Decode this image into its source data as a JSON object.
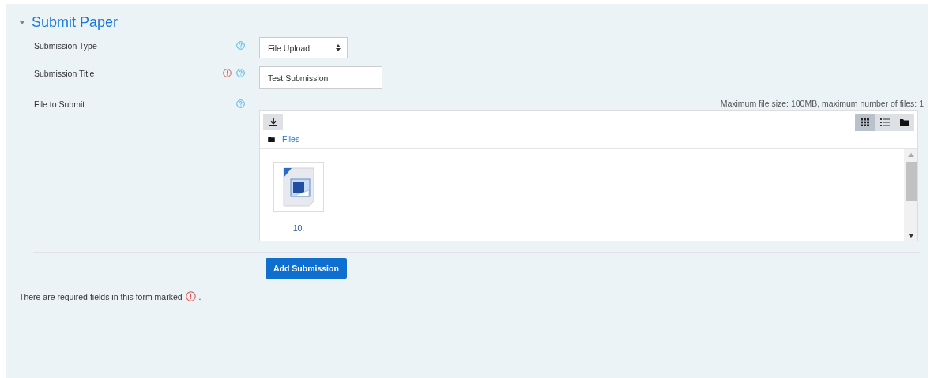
{
  "section": {
    "title": "Submit Paper",
    "expanded": true
  },
  "fields": [
    {
      "kind": "select",
      "label": "Submission Type",
      "required": false,
      "value": "File Upload"
    },
    {
      "kind": "text",
      "label": "Submission Title",
      "required": true,
      "value": "Test Submission"
    },
    {
      "kind": "filepicker",
      "label": "File to Submit",
      "required": false,
      "limits": "Maximum file size: 100MB, maximum number of files: 1",
      "path": "Files",
      "views": [
        {
          "kind": "icons",
          "selected": true
        },
        {
          "kind": "list",
          "selected": false
        },
        {
          "kind": "tree",
          "selected": false
        }
      ],
      "files": [
        {
          "name": "10."
        }
      ]
    }
  ],
  "submit_button": "Add Submission",
  "required_note": {
    "before": "There are required fields in this form marked",
    "after": "."
  }
}
